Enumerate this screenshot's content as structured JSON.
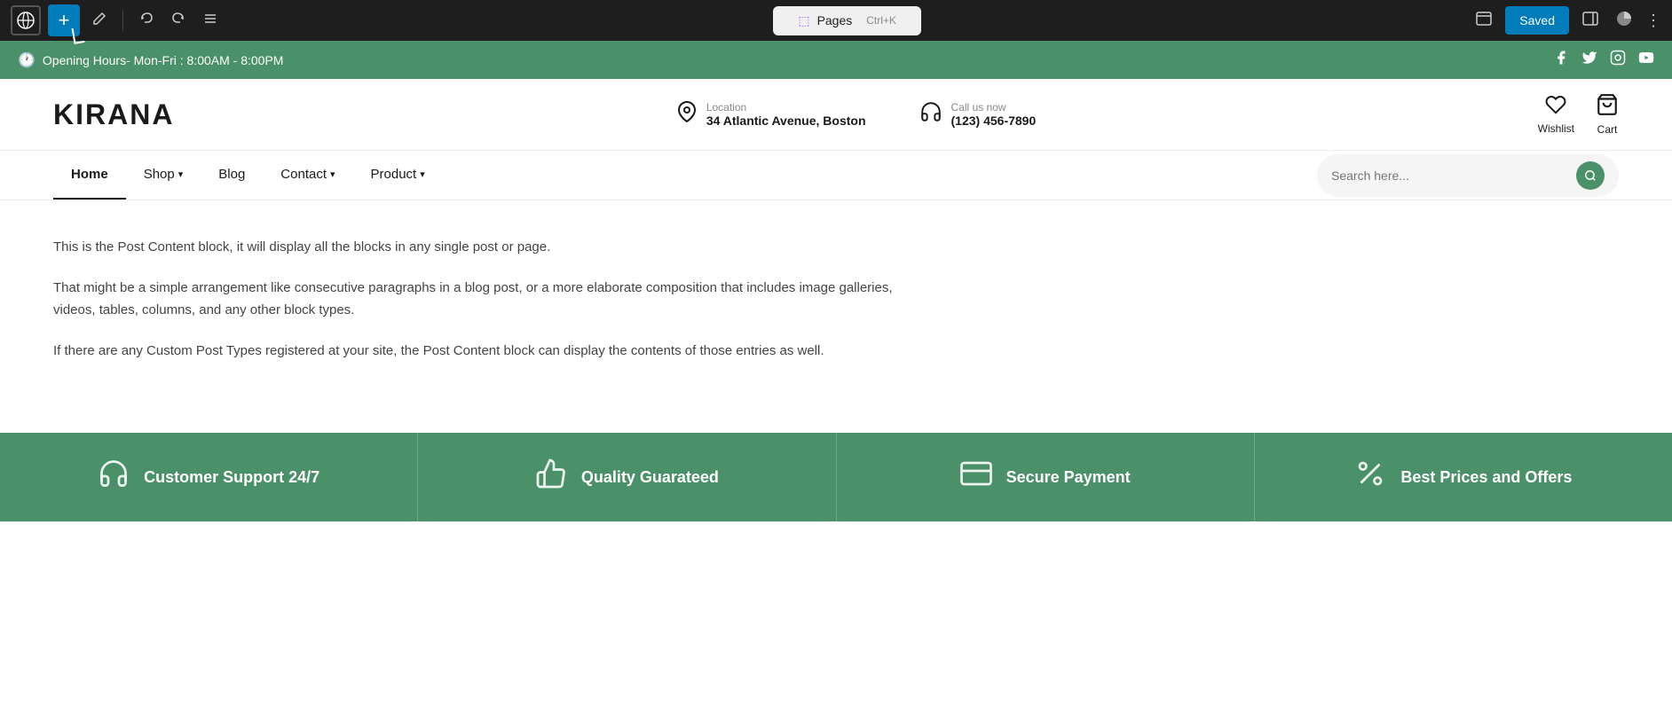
{
  "admin_bar": {
    "wp_logo": "W",
    "add_label": "+",
    "pages_label": "Pages",
    "shortcut": "Ctrl+K",
    "saved_label": "Saved",
    "undo_title": "Undo",
    "redo_title": "Redo",
    "tools_title": "Tools",
    "view_icon": "⬜",
    "sidebar_icon": "⬜",
    "appearance_icon": "◑",
    "more_icon": "⋮"
  },
  "announcement": {
    "icon": "🕐",
    "text": "Opening Hours- Mon-Fri : 8:00AM - 8:00PM"
  },
  "header": {
    "logo": "KIRANA",
    "location_label": "Location",
    "location_value": "34 Atlantic Avenue, Boston",
    "phone_label": "Call us now",
    "phone_value": "(123) 456-7890",
    "wishlist_label": "Wishlist",
    "cart_label": "Cart"
  },
  "nav": {
    "items": [
      {
        "label": "Home",
        "active": true,
        "has_dropdown": false
      },
      {
        "label": "Shop",
        "active": false,
        "has_dropdown": true
      },
      {
        "label": "Blog",
        "active": false,
        "has_dropdown": false
      },
      {
        "label": "Contact",
        "active": false,
        "has_dropdown": true
      },
      {
        "label": "Product",
        "active": false,
        "has_dropdown": true
      }
    ],
    "search_placeholder": "Search here..."
  },
  "content": {
    "paragraph1": "This is the Post Content block, it will display all the blocks in any single post or page.",
    "paragraph2": "That might be a simple arrangement like consecutive paragraphs in a blog post, or a more elaborate composition that includes image galleries, videos, tables, columns, and any other block types.",
    "paragraph3": "If there are any Custom Post Types registered at your site, the Post Content block can display the contents of those entries as well."
  },
  "footer": {
    "items": [
      {
        "icon": "🎧",
        "label": "Customer Support 24/7"
      },
      {
        "icon": "👍",
        "label": "Quality Guarateed"
      },
      {
        "icon": "💳",
        "label": "Secure Payment"
      },
      {
        "icon": "🏷",
        "label": "Best Prices and Offers"
      }
    ]
  }
}
